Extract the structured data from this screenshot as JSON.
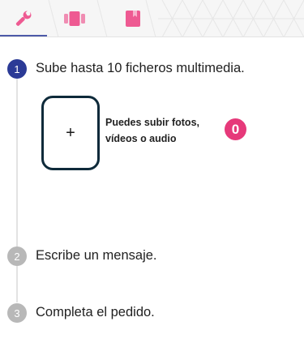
{
  "tabs": [
    {
      "icon": "wrench-icon",
      "active": true
    },
    {
      "icon": "media-gallery-icon",
      "active": false
    },
    {
      "icon": "book-icon",
      "active": false
    }
  ],
  "colors": {
    "active_step": "#2b3a96",
    "inactive_step": "#b8b8b8",
    "accent_pink": "#e6397a",
    "upload_border": "#0e2a3a",
    "tab_underline": "#4d5aa8"
  },
  "steps": [
    {
      "number": "1",
      "title": "Sube hasta 10 ficheros multimedia.",
      "active": true
    },
    {
      "number": "2",
      "title": "Escribe un mensaje.",
      "active": false
    },
    {
      "number": "3",
      "title": "Completa el pedido.",
      "active": false
    }
  ],
  "upload": {
    "plus": "+",
    "hint_line1": "Puedes subir fotos,",
    "hint_line2": "vídeos o audio",
    "count": "0"
  }
}
